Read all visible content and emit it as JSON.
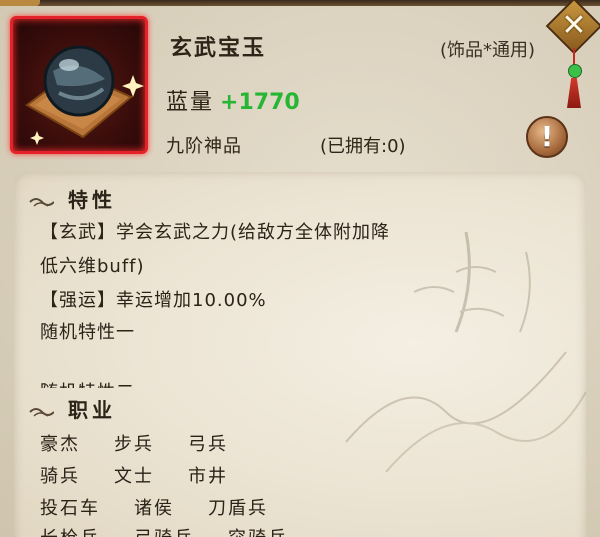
{
  "item": {
    "name": "玄武宝玉",
    "slot": "(饰品*通用)",
    "stat_label": "蓝量",
    "stat_value": "+1770",
    "grade": "九阶神品",
    "owned": "(已拥有:0)",
    "icon": "jade-orb-icon"
  },
  "colors": {
    "frame_border": "#e3222a",
    "stat_value": "#27b633",
    "text": "#2b2218"
  },
  "traits": {
    "header": "特性",
    "lines": [
      "【玄武】学会玄武之力(给敌方全体附加降",
      "低六维buff)",
      "【强运】幸运增加10.00%",
      "随机特性一"
    ],
    "clipped_line": "随机特性二"
  },
  "jobs": {
    "header": "职业",
    "rows": [
      [
        "豪杰",
        "步兵",
        "弓兵"
      ],
      [
        "骑兵",
        "文士",
        "市井"
      ],
      [
        "投石车",
        "诸侯",
        "刀盾兵"
      ],
      [
        "长枪兵",
        "弓骑兵",
        "突骑兵"
      ]
    ]
  },
  "buttons": {
    "info_icon": "exclamation-icon",
    "info_label": "!",
    "close_icon": "close-icon",
    "close_label": "✕"
  }
}
